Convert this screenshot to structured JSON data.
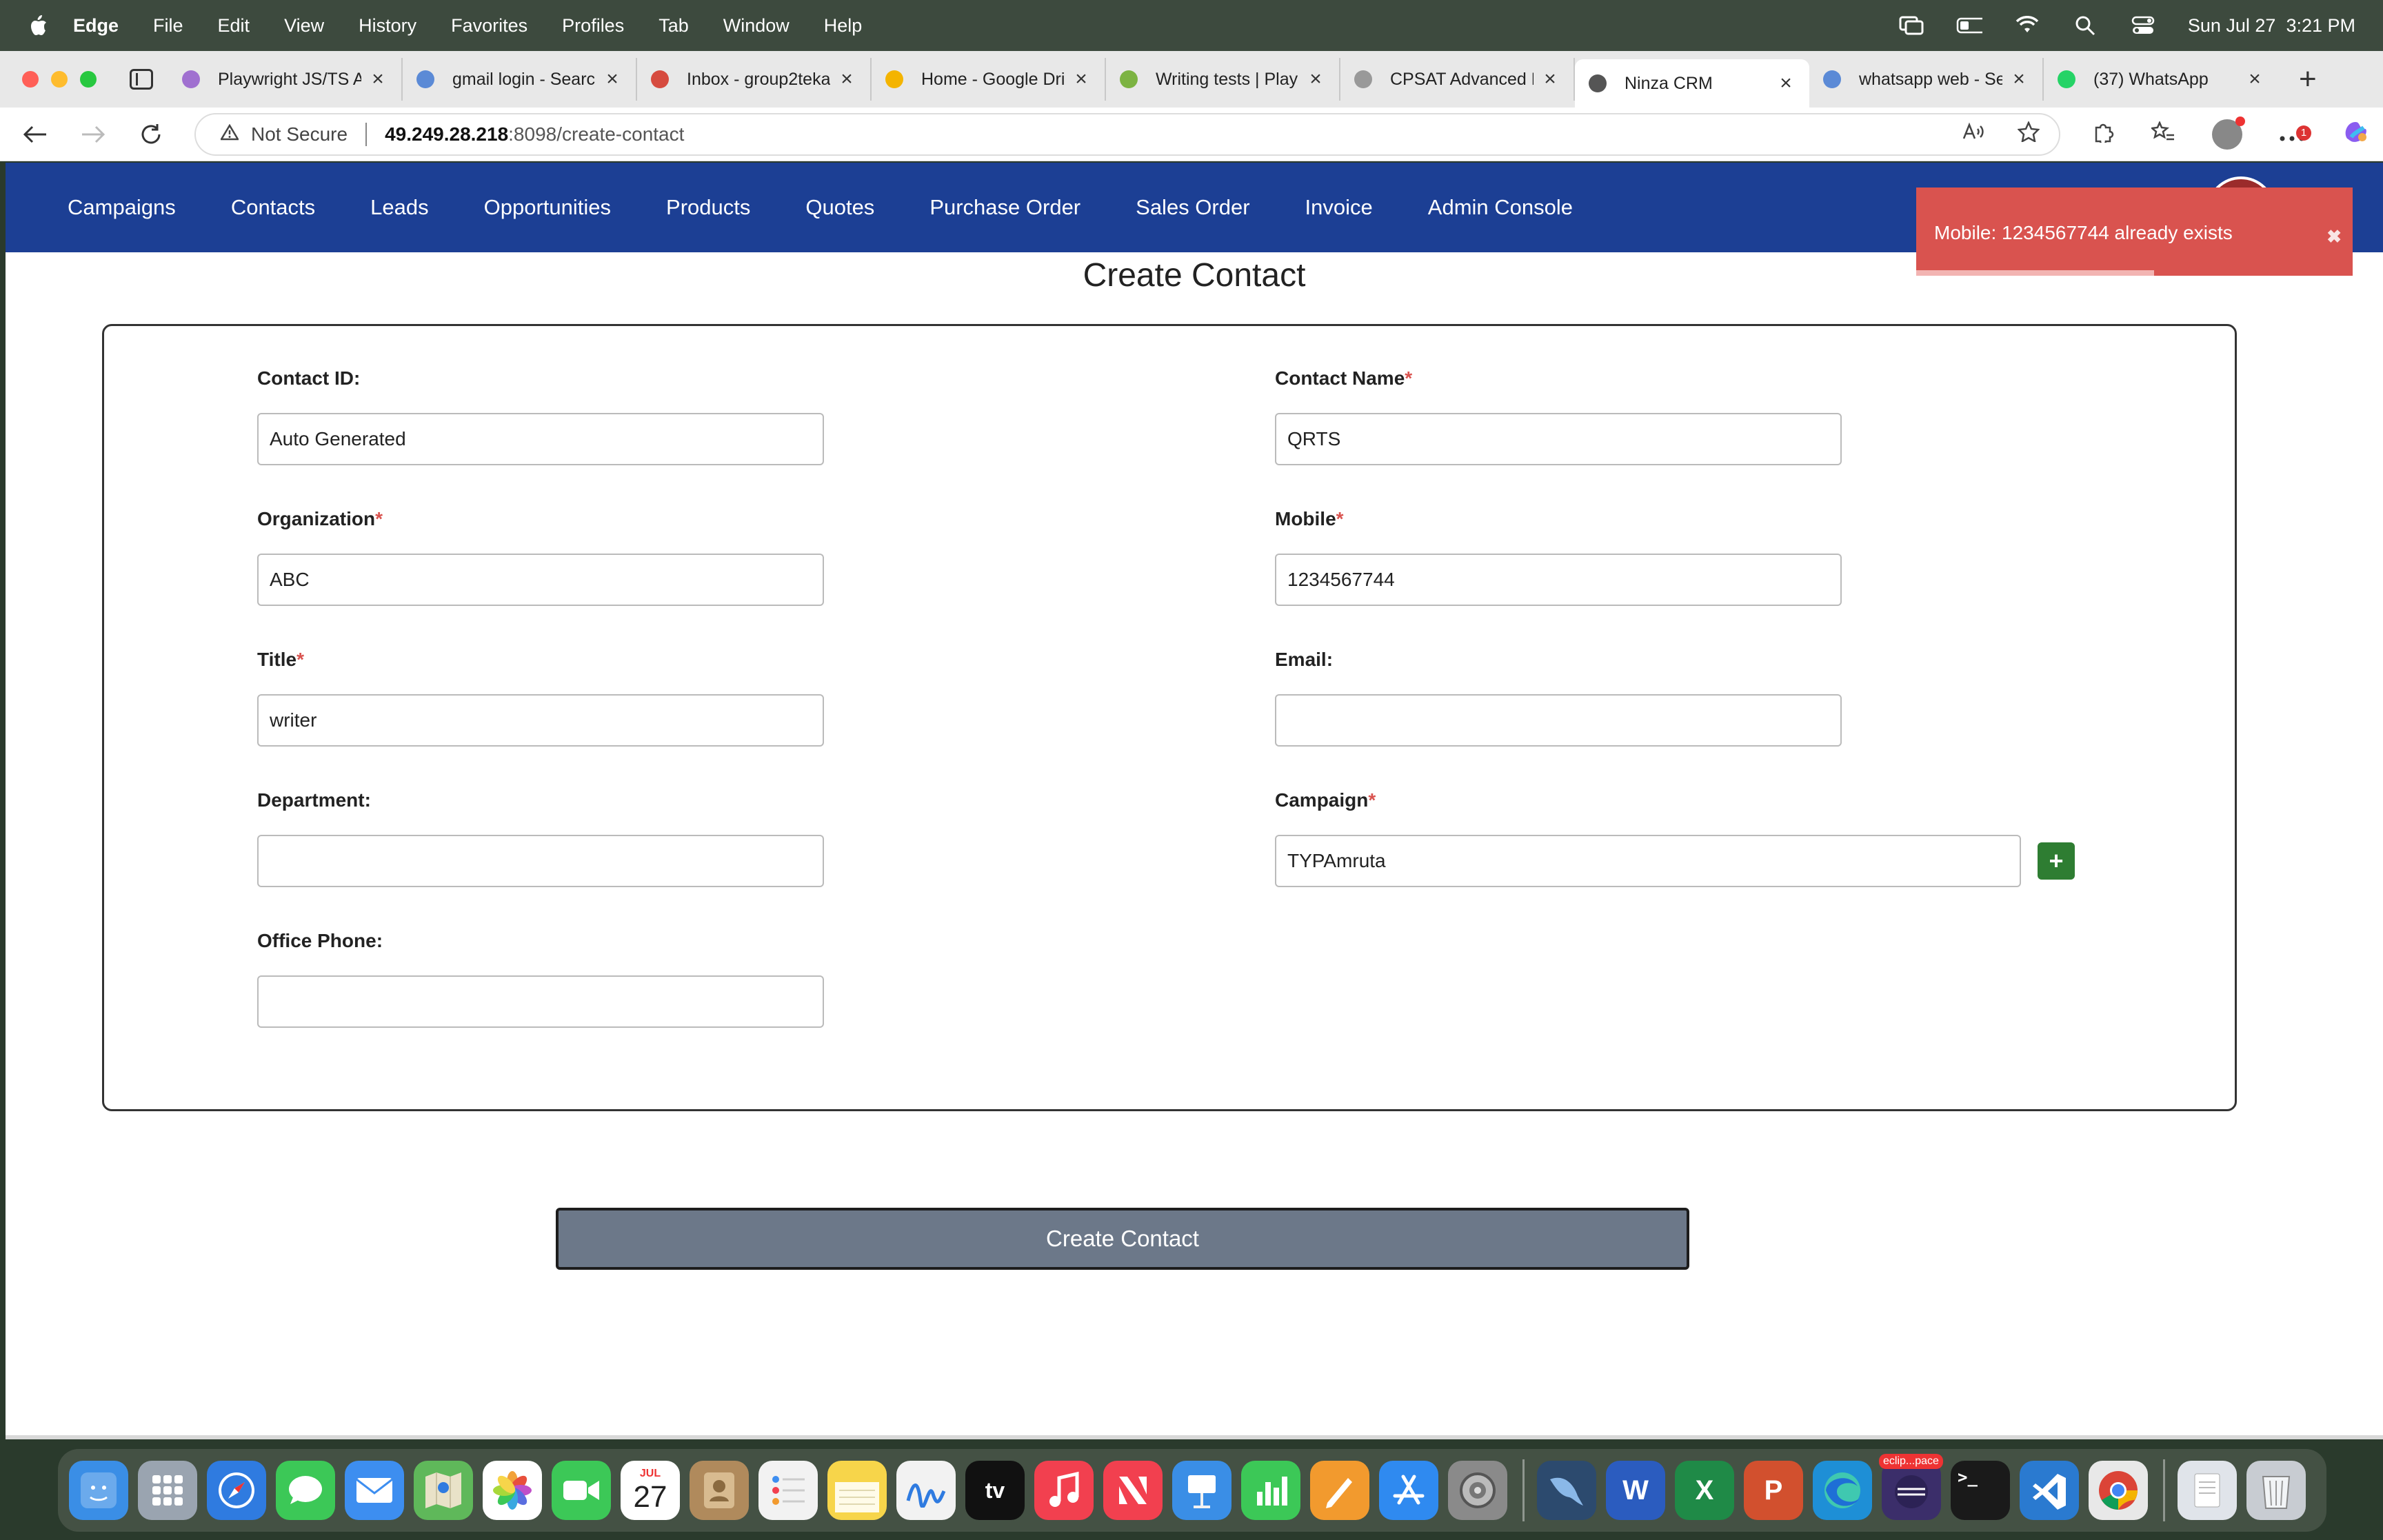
{
  "menubar": {
    "app_name": "Edge",
    "items": [
      "File",
      "Edit",
      "View",
      "History",
      "Favorites",
      "Profiles",
      "Tab",
      "Window",
      "Help"
    ],
    "clock": "Sun Jul 27  3:21 PM"
  },
  "browser": {
    "tabs": [
      {
        "label": "Playwright JS/TS A",
        "color": "#a070d0"
      },
      {
        "label": "gmail login - Search",
        "color": "#5b8ad6"
      },
      {
        "label": "Inbox - group2teka",
        "color": "#d64b3f"
      },
      {
        "label": "Home - Google Dri",
        "color": "#f4b400"
      },
      {
        "label": "Writing tests | Play",
        "color": "#7cb342"
      },
      {
        "label": "CPSAT Advanced E",
        "color": "#999999"
      },
      {
        "label": "Ninza CRM",
        "color": "#555555"
      },
      {
        "label": "whatsapp web - Se",
        "color": "#5b8ad6"
      },
      {
        "label": "(37) WhatsApp",
        "color": "#25d366"
      }
    ],
    "address": {
      "security": "Not Secure",
      "host": "49.249.28.218",
      "path": ":8098/create-contact"
    }
  },
  "navbar": {
    "items": [
      "Campaigns",
      "Contacts",
      "Leads",
      "Opportunities",
      "Products",
      "Quotes",
      "Purchase Order",
      "Sales Order",
      "Invoice",
      "Admin Console"
    ]
  },
  "toast": {
    "message": "Mobile: 1234567744 already exists",
    "close": "✖"
  },
  "page": {
    "title": "Create Contact"
  },
  "form": {
    "contact_id": {
      "label": "Contact ID:",
      "value": "Auto Generated"
    },
    "contact_name": {
      "label": "Contact Name",
      "value": "QRTS"
    },
    "organization": {
      "label": "Organization",
      "value": "ABC"
    },
    "mobile": {
      "label": "Mobile",
      "value": "1234567744"
    },
    "title": {
      "label": "Title",
      "value": "writer"
    },
    "email": {
      "label": "Email:",
      "value": ""
    },
    "department": {
      "label": "Department:",
      "value": ""
    },
    "campaign": {
      "label": "Campaign",
      "value": "TYPAmruta",
      "add": "+"
    },
    "office_phone": {
      "label": "Office Phone:",
      "value": ""
    },
    "required_mark": "*",
    "submit": "Create Contact"
  },
  "dock": {
    "calendar_month": "JUL",
    "calendar_day": "27",
    "apps": [
      {
        "name": "finder-icon",
        "color": "#3a8ee6"
      },
      {
        "name": "launchpad-icon",
        "color": "#9aa4b0"
      },
      {
        "name": "safari-icon",
        "color": "#2f7be0"
      },
      {
        "name": "messages-icon",
        "color": "#3cc857"
      },
      {
        "name": "mail-icon",
        "color": "#3d8ef0"
      },
      {
        "name": "maps-icon",
        "color": "#5fb85a"
      },
      {
        "name": "photos-icon",
        "color": "#e8a03c"
      },
      {
        "name": "facetime-icon",
        "color": "#3cc857"
      },
      {
        "name": "calendar-icon",
        "color": "#ffffff"
      },
      {
        "name": "contacts-icon",
        "color": "#b08a5c"
      },
      {
        "name": "reminders-icon",
        "color": "#f2f2f2"
      },
      {
        "name": "notes-icon",
        "color": "#f7d54a"
      },
      {
        "name": "freeform-icon",
        "color": "#f2f2f2"
      },
      {
        "name": "appletv-icon",
        "color": "#111111"
      },
      {
        "name": "music-icon",
        "color": "#f2404f"
      },
      {
        "name": "news-icon",
        "color": "#f2404f"
      },
      {
        "name": "keynote-icon",
        "color": "#3a8ee6"
      },
      {
        "name": "numbers-icon",
        "color": "#3cc857"
      },
      {
        "name": "pages-icon",
        "color": "#f29a2e"
      },
      {
        "name": "appstore-icon",
        "color": "#2f8af0"
      },
      {
        "name": "settings-icon",
        "color": "#8a8a8a"
      },
      {
        "name": "mysql-workbench-icon",
        "color": "#2c4a6e"
      },
      {
        "name": "word-icon",
        "color": "#2b5cbf"
      },
      {
        "name": "excel-icon",
        "color": "#1f8a47"
      },
      {
        "name": "powerpoint-icon",
        "color": "#d2502e"
      },
      {
        "name": "edge-icon",
        "color": "#1e8fd6"
      },
      {
        "name": "eclipse-icon",
        "color": "#3b2e6a"
      },
      {
        "name": "terminal-icon",
        "color": "#1a1a1a"
      },
      {
        "name": "vscode-icon",
        "color": "#2a7ad0"
      },
      {
        "name": "chrome-icon",
        "color": "#e8e8e8"
      },
      {
        "name": "documents-icon",
        "color": "#e0e4ea"
      },
      {
        "name": "trash-icon",
        "color": "#c8ccd2"
      }
    ],
    "eclipse_badge": "eclip...pace",
    "terminal_glyph": ">_",
    "word_letter": "W",
    "excel_letter": "X",
    "powerpoint_letter": "P",
    "tv_label": "tv"
  }
}
